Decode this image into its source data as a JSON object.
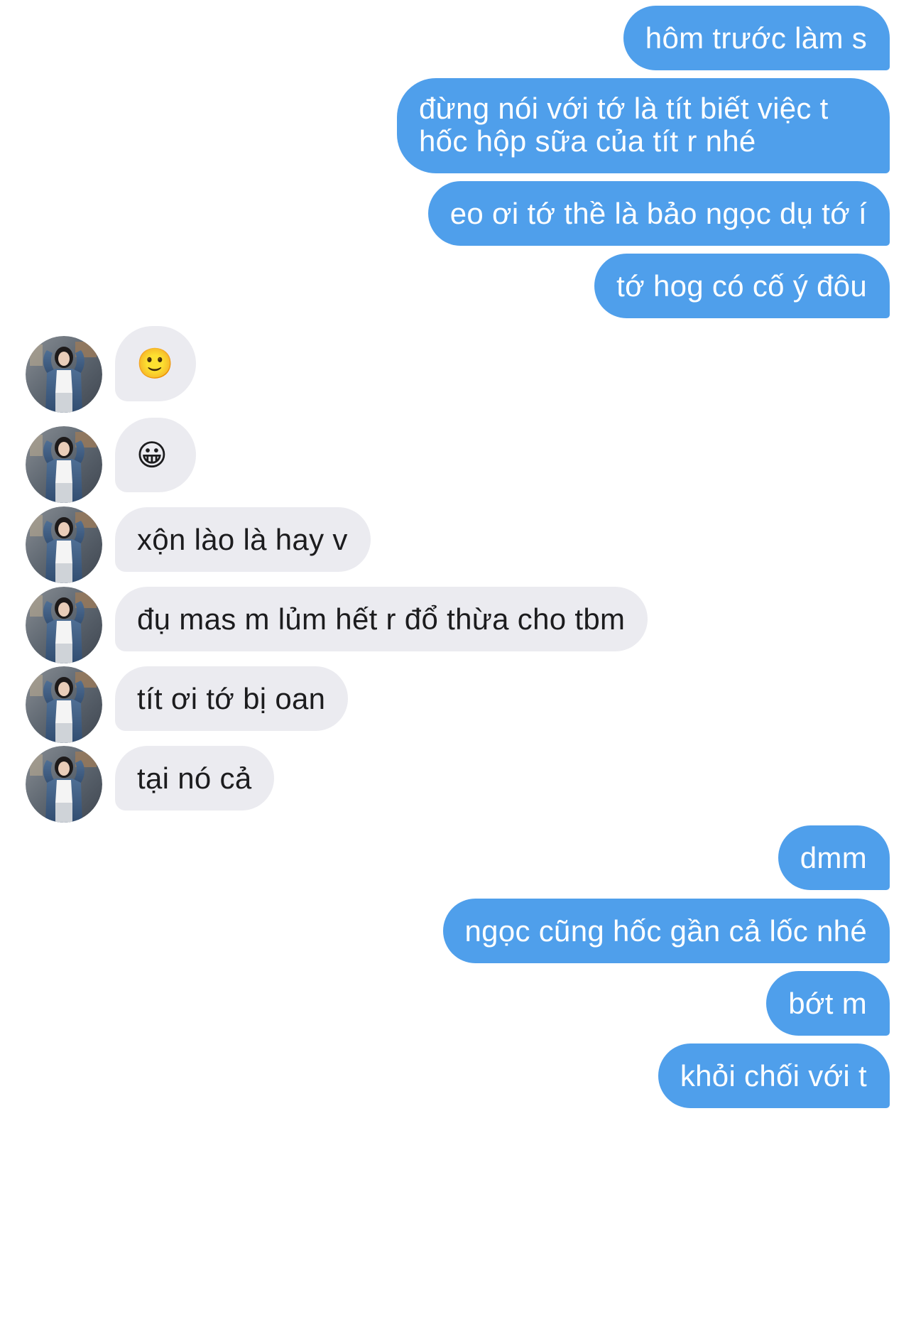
{
  "conversation": {
    "messages": [
      {
        "id": 1,
        "direction": "sent",
        "text": "hôm trước làm s"
      },
      {
        "id": 2,
        "direction": "sent",
        "text": "đừng nói với tớ là tít biết việc t hốc hộp sữa của tít r nhé"
      },
      {
        "id": 3,
        "direction": "sent",
        "text": "eo ơi tớ thề là bảo ngọc dụ tớ í"
      },
      {
        "id": 4,
        "direction": "sent",
        "text": "tớ hog có cố ý đôu"
      },
      {
        "id": 5,
        "direction": "received",
        "text": "🙂",
        "icon": "slightly-smiling-face-emoji"
      },
      {
        "id": 6,
        "direction": "received",
        "text": "😀",
        "icon": "grinning-face-emoji"
      },
      {
        "id": 7,
        "direction": "received",
        "text": "xộn lào là hay v"
      },
      {
        "id": 8,
        "direction": "received",
        "text": "đụ mas m lủm hết r đổ thừa cho tbm"
      },
      {
        "id": 9,
        "direction": "received",
        "text": "tít ơi tớ bị oan"
      },
      {
        "id": 10,
        "direction": "received",
        "text": "tại nó cả"
      },
      {
        "id": 11,
        "direction": "sent",
        "text": "dmm"
      },
      {
        "id": 12,
        "direction": "sent",
        "text": "ngọc cũng hốc gần cả lốc nhé"
      },
      {
        "id": 13,
        "direction": "sent",
        "text": "bớt m"
      },
      {
        "id": 14,
        "direction": "sent",
        "text": "khỏi chối với t"
      }
    ]
  },
  "colors": {
    "sent_bubble": "#4f9feb",
    "sent_text": "#ffffff",
    "received_bubble": "#ebebf0",
    "received_text": "#1c1c1e",
    "background": "#ffffff"
  }
}
